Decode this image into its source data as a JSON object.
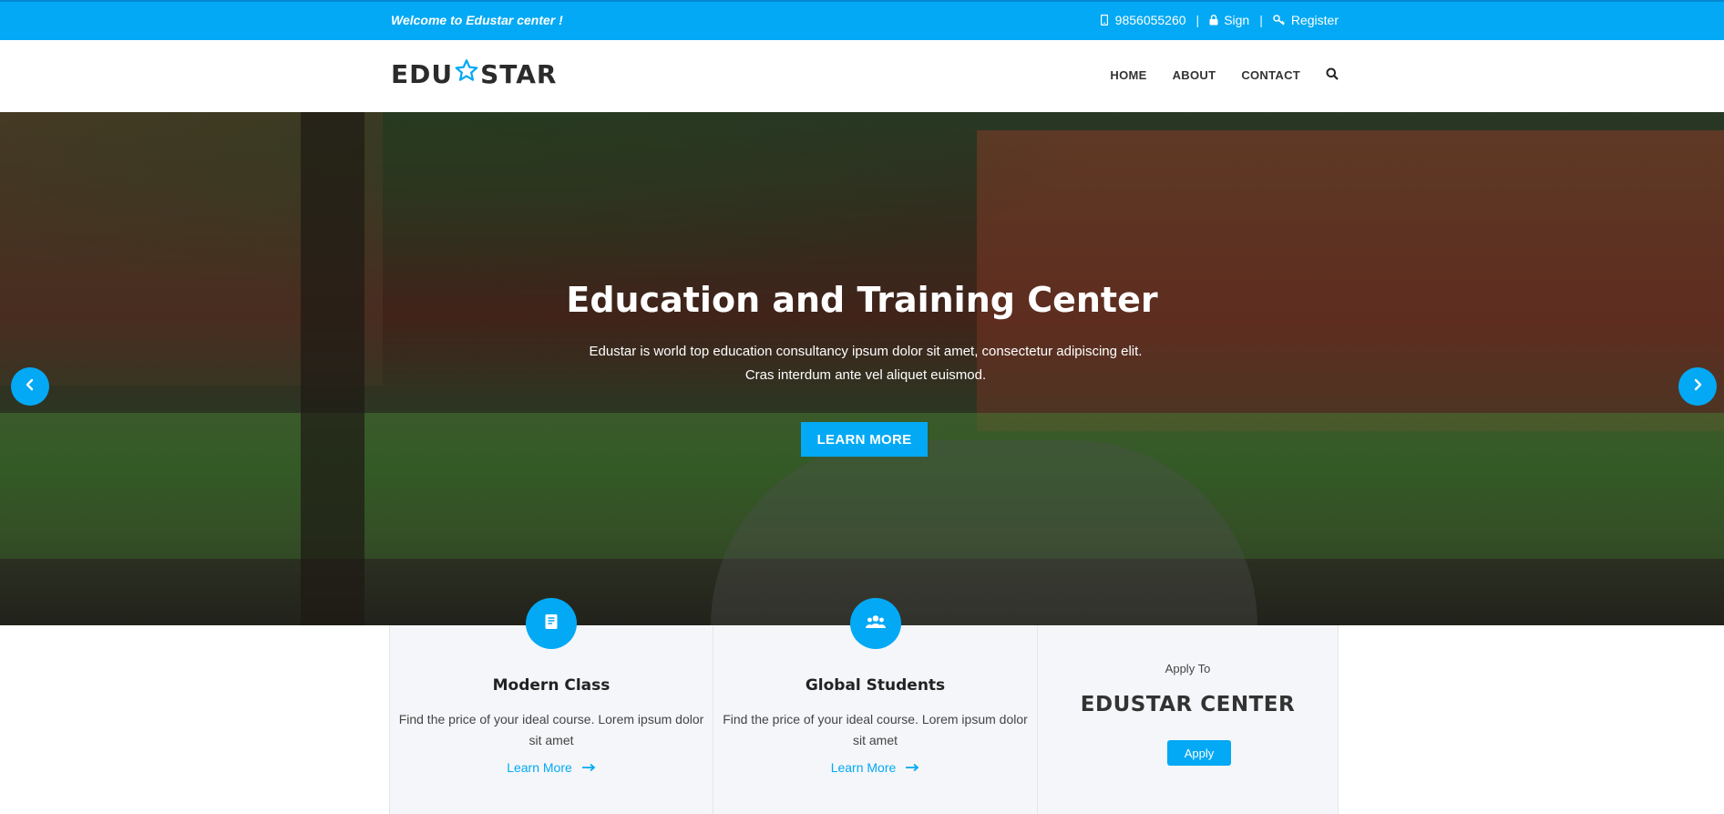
{
  "topbar": {
    "welcome": "Welcome to Edustar center !",
    "phone": "9856055260",
    "sign_label": "Sign",
    "register_label": "Register"
  },
  "header": {
    "logo_left": "EDU",
    "logo_right": "STAR",
    "nav": [
      {
        "label": "HOME"
      },
      {
        "label": "ABOUT"
      },
      {
        "label": "CONTACT"
      }
    ]
  },
  "hero": {
    "title": "Education and Training Center",
    "subtitle": "Edustar is world top education consultancy ipsum dolor sit amet, consectetur adipiscing elit. Cras interdum ante vel aliquet euismod.",
    "button_label": "LEARN MORE"
  },
  "cards": [
    {
      "icon": "book-icon",
      "title": "Modern Class",
      "text": "Find the price of your ideal course. Lorem ipsum dolor sit amet",
      "link": "Learn More"
    },
    {
      "icon": "users-icon",
      "title": "Global Students",
      "text": "Find the price of your ideal course. Lorem ipsum dolor sit amet",
      "link": "Learn More"
    },
    {
      "apply_to": "Apply To",
      "center_title": "EDUSTAR CENTER",
      "button_label": "Apply"
    }
  ],
  "colors": {
    "accent": "#03a9f4",
    "text_dark": "#222222"
  }
}
